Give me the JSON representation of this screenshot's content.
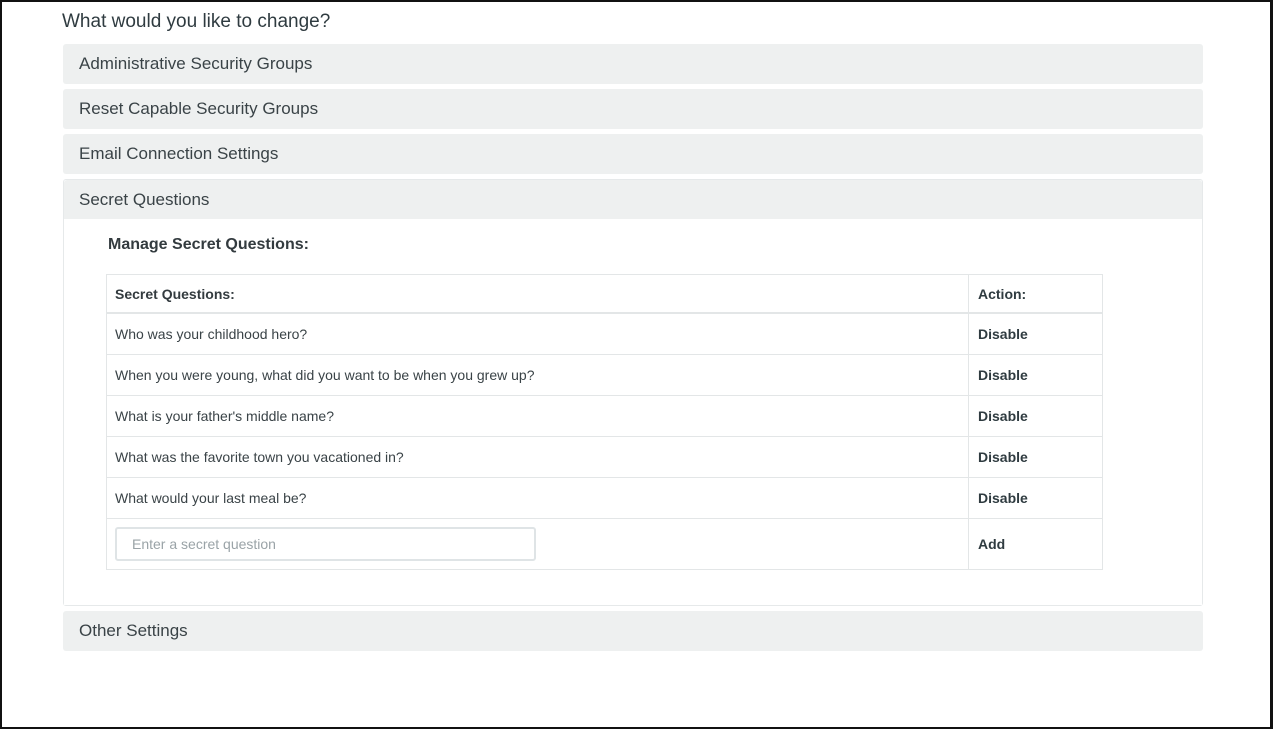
{
  "page": {
    "heading": "What would you like to change?"
  },
  "sections": [
    {
      "label": "Administrative Security Groups"
    },
    {
      "label": "Reset Capable Security Groups"
    },
    {
      "label": "Email Connection Settings"
    },
    {
      "label": "Secret Questions"
    },
    {
      "label": "Other Settings"
    }
  ],
  "secret_questions": {
    "title": "Manage Secret Questions:",
    "columns": {
      "question": "Secret Questions:",
      "action": "Action:"
    },
    "rows": [
      {
        "question": "Who was your childhood hero?",
        "action": "Disable"
      },
      {
        "question": "When you were young, what did you want to be when you grew up?",
        "action": "Disable"
      },
      {
        "question": "What is your father's middle name?",
        "action": "Disable"
      },
      {
        "question": "What was the favorite town you vacationed in?",
        "action": "Disable"
      },
      {
        "question": "What would your last meal be?",
        "action": "Disable"
      }
    ],
    "new_question": {
      "value": "",
      "placeholder": "Enter a secret question",
      "action": "Add"
    }
  }
}
